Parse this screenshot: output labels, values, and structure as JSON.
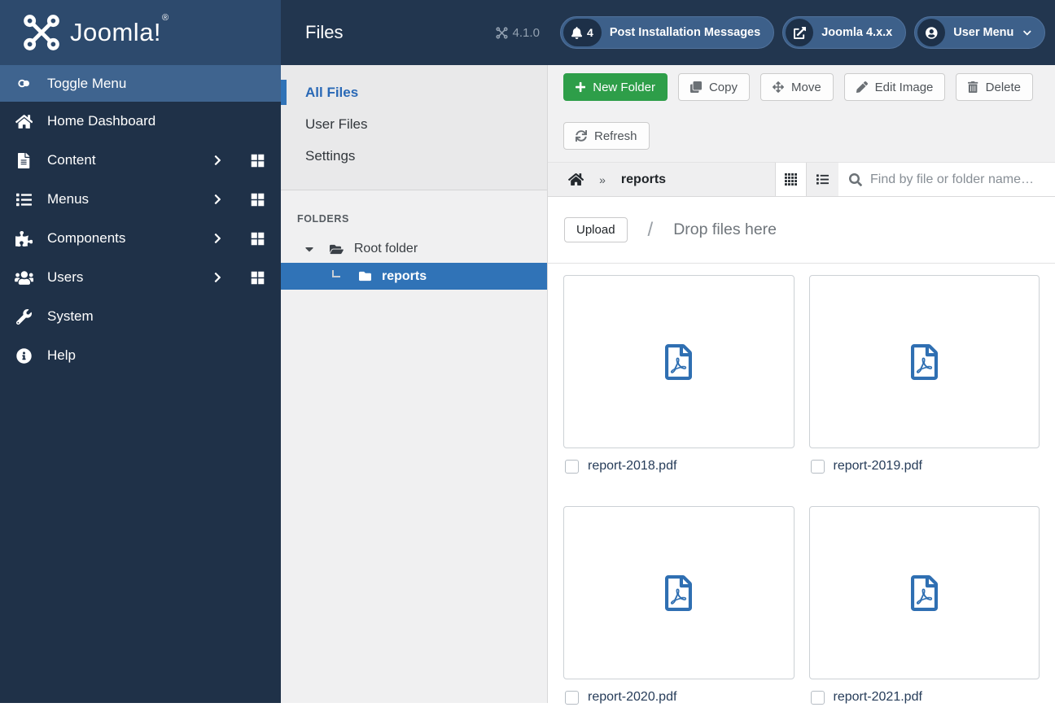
{
  "brand": {
    "logo_text": "Joomla!",
    "trademark": "®"
  },
  "topbar": {
    "page_title": "Files",
    "version": "4.1.0",
    "post_installation": {
      "count": "4",
      "label": "Post Installation Messages"
    },
    "joomla_link": {
      "label": "Joomla 4.x.x"
    },
    "user_menu": {
      "label": "User Menu"
    }
  },
  "sidebar": {
    "items": [
      {
        "label": "Toggle Menu",
        "icon": "toggle-icon"
      },
      {
        "label": "Home Dashboard",
        "icon": "home-icon"
      },
      {
        "label": "Content",
        "icon": "file-icon",
        "has_submenu": true,
        "has_dashboard": true
      },
      {
        "label": "Menus",
        "icon": "list-icon",
        "has_submenu": true,
        "has_dashboard": true
      },
      {
        "label": "Components",
        "icon": "puzzle-icon",
        "has_submenu": true,
        "has_dashboard": true
      },
      {
        "label": "Users",
        "icon": "users-icon",
        "has_submenu": true,
        "has_dashboard": true
      },
      {
        "label": "System",
        "icon": "wrench-icon"
      },
      {
        "label": "Help",
        "icon": "info-circle-icon"
      }
    ]
  },
  "media_sidebar": {
    "tabs": [
      {
        "label": "All Files",
        "active": true
      },
      {
        "label": "User Files",
        "active": false
      },
      {
        "label": "Settings",
        "active": false
      }
    ],
    "folders_heading": "FOLDERS",
    "root_folder": "Root folder",
    "selected_folder": "reports"
  },
  "toolbar": {
    "buttons": [
      {
        "label": "New Folder",
        "icon": "plus-icon",
        "variant": "success"
      },
      {
        "label": "Copy",
        "icon": "copy-icon"
      },
      {
        "label": "Move",
        "icon": "move-icon"
      },
      {
        "label": "Edit Image",
        "icon": "pencil-icon"
      },
      {
        "label": "Delete",
        "icon": "trash-icon"
      },
      {
        "label": "Refresh",
        "icon": "refresh-icon"
      }
    ]
  },
  "breadcrumb": {
    "separator": "»",
    "current": "reports"
  },
  "search": {
    "placeholder": "Find by file or folder name…"
  },
  "dropzone": {
    "upload_label": "Upload",
    "separator": "/",
    "hint": "Drop files here"
  },
  "files": {
    "items": [
      {
        "name": "report-2018.pdf",
        "type": "pdf",
        "checked": false
      },
      {
        "name": "report-2019.pdf",
        "type": "pdf",
        "checked": false
      },
      {
        "name": "report-2020.pdf",
        "type": "pdf",
        "checked": false
      },
      {
        "name": "report-2021.pdf",
        "type": "pdf",
        "checked": false
      }
    ]
  },
  "colors": {
    "logo_bg": "#2d4a6d",
    "topbar_bg": "#22364f",
    "sidebar_bg": "#1f3148",
    "sidebar_highlight": "#3f648f",
    "accent_blue": "#3073b7",
    "link_blue": "#2a69b6",
    "success_green": "#2e9e49",
    "pdf_icon_blue": "#2f6fb2"
  }
}
